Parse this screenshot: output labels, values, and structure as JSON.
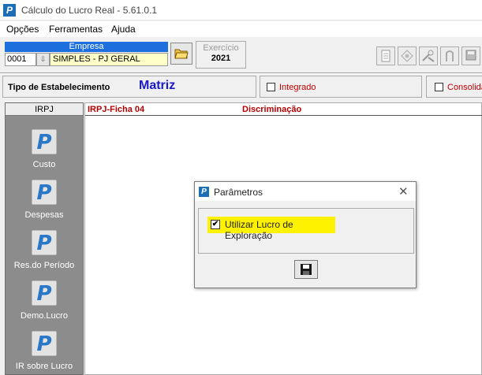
{
  "window": {
    "title": "Cálculo do Lucro Real - 5.61.0.1",
    "app_icon": "P"
  },
  "menu": [
    "Opções",
    "Ferramentas",
    "Ajuda"
  ],
  "empresa": {
    "label": "Empresa",
    "code": "0001",
    "name": "SIMPLES - PJ GERAL"
  },
  "exercicio": {
    "label": "Exercício",
    "value": "2021"
  },
  "estabelecimento": {
    "label": "Tipo de Estabelecimento",
    "value": "Matriz"
  },
  "options": {
    "integrado": "Integrado",
    "consolidado": "Consolida"
  },
  "sidebar": {
    "header": "IRPJ",
    "items": [
      {
        "label": "Custo",
        "icon": "P"
      },
      {
        "label": "Despesas",
        "icon": "P"
      },
      {
        "label": "Res.do Período",
        "icon": "P"
      },
      {
        "label": "Demo.Lucro",
        "icon": "P"
      },
      {
        "label": "IR sobre Lucro",
        "icon": "P"
      }
    ]
  },
  "grid": {
    "col1": "IRPJ-Ficha 04",
    "col2": "Discriminação"
  },
  "dialog": {
    "title": "Parâmetros",
    "icon": "P",
    "close": "✕",
    "option_label": "Utilizar Lucro de Exploração",
    "option_checked": "✔"
  },
  "colors": {
    "accent": "#1c6fdc",
    "highlight": "#fff200",
    "header_red": "#b30000",
    "estab_blue": "#1a1acd"
  }
}
